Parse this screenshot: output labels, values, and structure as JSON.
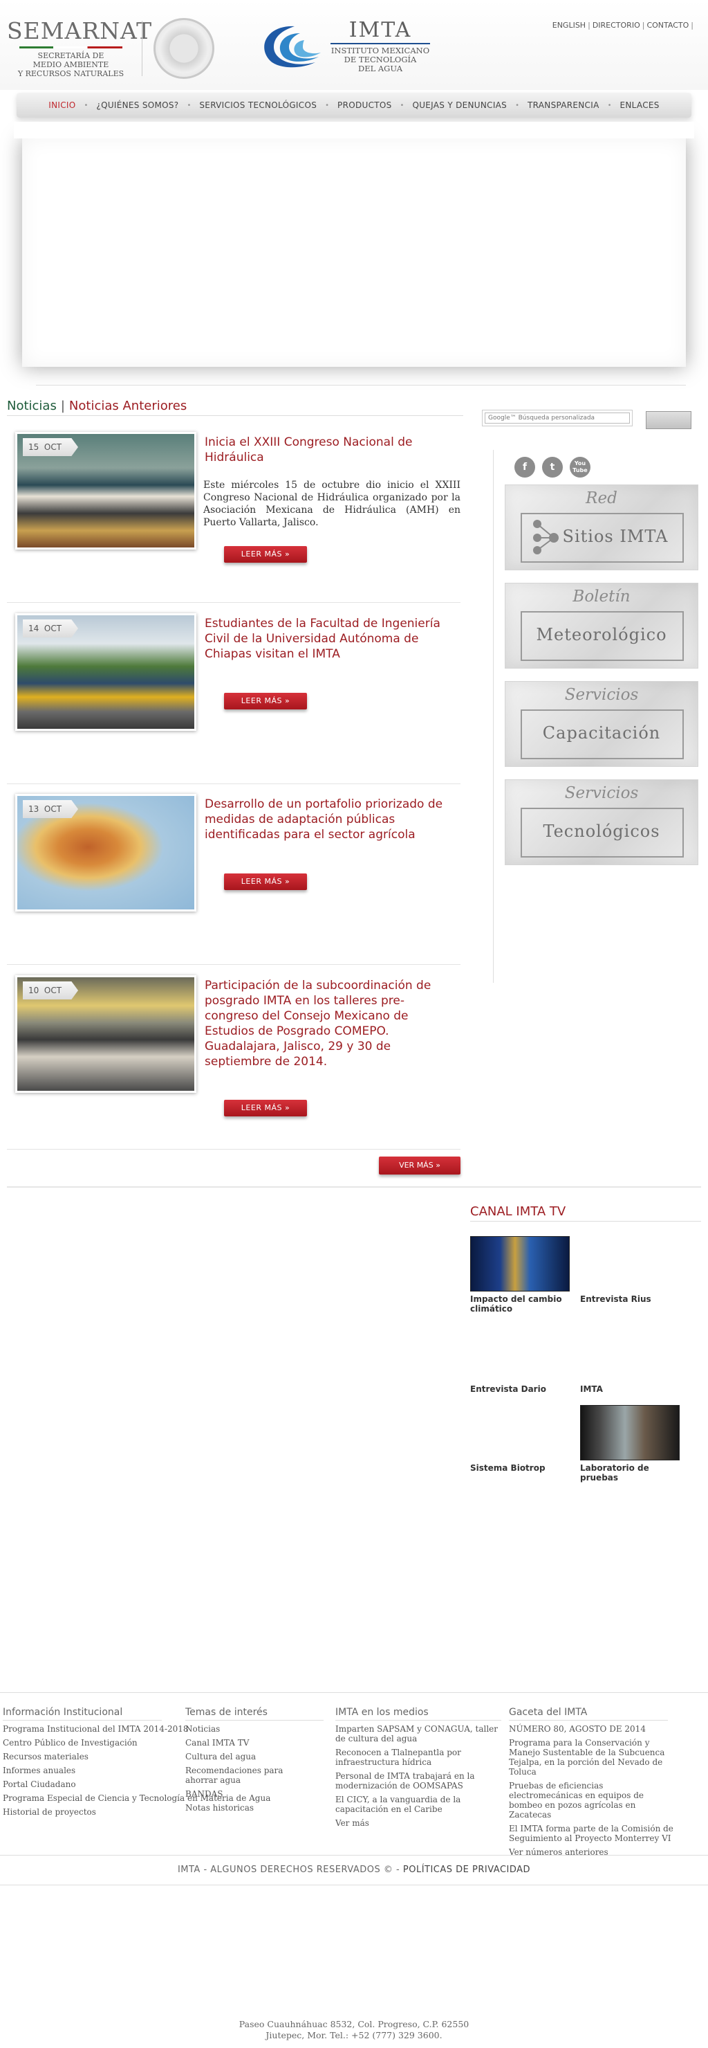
{
  "header": {
    "semarnat_title": "SEMARNAT",
    "semarnat_sub1": "SECRETARÍA DE",
    "semarnat_sub2": "MEDIO AMBIENTE",
    "semarnat_sub3": "Y RECURSOS NATURALES",
    "imta_title": "IMTA",
    "imta_sub1": "INSTITUTO MEXICANO",
    "imta_sub2": "DE TECNOLOGÍA",
    "imta_sub3": "DEL AGUA",
    "top_links": [
      "ENGLISH",
      "DIRECTORIO",
      "CONTACTO"
    ]
  },
  "nav": {
    "items": [
      "INICIO",
      "¿QUIÉNES SOMOS?",
      "SERVICIOS TECNOLÓGICOS",
      "PRODUCTOS",
      "QUEJAS Y DENUNCIAS",
      "TRANSPARENCIA",
      "ENLACES"
    ],
    "active": "INICIO"
  },
  "news": {
    "tab_current": "Noticias",
    "tab_separator": "|",
    "tab_previous": "Noticias Anteriores",
    "read_more_label": "LEER MÁS »",
    "see_more_label": "VER MÁS »",
    "items": [
      {
        "day": "15",
        "month": "OCT",
        "title": "Inicia el XXIII Congreso Nacional de Hidráulica",
        "summary": "Este miércoles 15 de octubre dio inicio el XXIII Congreso Nacional de Hidráulica organizado por la Asociación Mexicana de Hidráulica (AMH) en Puerto Vallarta, Jalisco."
      },
      {
        "day": "14",
        "month": "OCT",
        "title": "Estudiantes de la Facultad de Ingeniería Civil de la Universidad Autónoma de Chiapas visitan el IMTA",
        "summary": ""
      },
      {
        "day": "13",
        "month": "OCT",
        "title": "Desarrollo de un portafolio priorizado de medidas de adaptación públicas identificadas para el sector agrícola",
        "summary": ""
      },
      {
        "day": "10",
        "month": "OCT",
        "title": "Participación de la subcoordinación de posgrado IMTA en los talleres pre-congreso del Consejo Mexicano de Estudios de Posgrado COMEPO. Guadalajara, Jalisco, 29 y 30 de septiembre de 2014.",
        "summary": ""
      }
    ]
  },
  "sidebar": {
    "search_placeholder": "Búsqueda personalizada",
    "search_brand": "Google™",
    "social": [
      "f",
      "t",
      "You Tube"
    ],
    "banners": [
      {
        "top": "Red",
        "bottom": "Sitios IMTA"
      },
      {
        "top": "Boletín",
        "bottom": "Meteorológico"
      },
      {
        "top": "Servicios",
        "bottom": "Capacitación"
      },
      {
        "top": "Servicios",
        "bottom": "Tecnológicos"
      }
    ]
  },
  "tv": {
    "title": "CANAL IMTA TV",
    "videos": [
      "Impacto del cambio climático",
      "Entrevista Rius",
      "Entrevista Dario",
      "IMTA",
      "Sistema Biotrop",
      "Laboratorio de pruebas"
    ]
  },
  "footer": {
    "columns": [
      {
        "head": "Información Institucional",
        "links": [
          "Programa Institucional del IMTA 2014-2018",
          "Centro Público de Investigación",
          "Recursos materiales",
          "Informes anuales",
          "Portal Ciudadano",
          "Programa Especial de Ciencia y Tecnología en Materia de Agua",
          "Historial de proyectos"
        ]
      },
      {
        "head": "Temas de interés",
        "links": [
          "Noticias",
          "Canal IMTA TV",
          "Cultura del agua",
          "Recomendaciones para ahorrar agua",
          "BANDAS",
          "Notas historicas"
        ]
      },
      {
        "head": "IMTA en los medios",
        "links": [
          "Imparten SAPSAM y CONAGUA, taller de cultura del agua",
          "Reconocen a Tlalnepantla por infraestructura hídrica",
          "Personal de IMTA trabajará en la modernización de OOMSAPAS",
          "El CICY, a la vanguardia de la capacitación en el Caribe",
          "Ver más"
        ]
      },
      {
        "head": "Gaceta del IMTA",
        "links": [
          "NÚMERO 80, AGOSTO DE 2014",
          "Programa para la Conservación y Manejo Sustentable de la Subcuenca Tejalpa, en la porción del Nevado de Toluca",
          "Pruebas de eficiencias electromecánicas en equipos de bombeo en pozos agrícolas en Zacatecas",
          "El IMTA forma parte de la Comisión de Seguimiento al Proyecto Monterrey VI",
          "Ver números anteriores"
        ]
      }
    ],
    "rights": "IMTA - ALGUNOS DERECHOS RESERVADOS ©",
    "rights_sep": "-",
    "privacy": "POLÍTICAS DE PRIVACIDAD",
    "address_line1": "Paseo Cuauhnáhuac 8532, Col. Progreso, C.P. 62550",
    "address_line2": "Jiutepec, Mor. Tel.: +52 (777) 329 3600."
  },
  "colors": {
    "brand_red": "#9c1d22",
    "brand_green": "#1e5b3a",
    "button_red": "#c0272d"
  }
}
